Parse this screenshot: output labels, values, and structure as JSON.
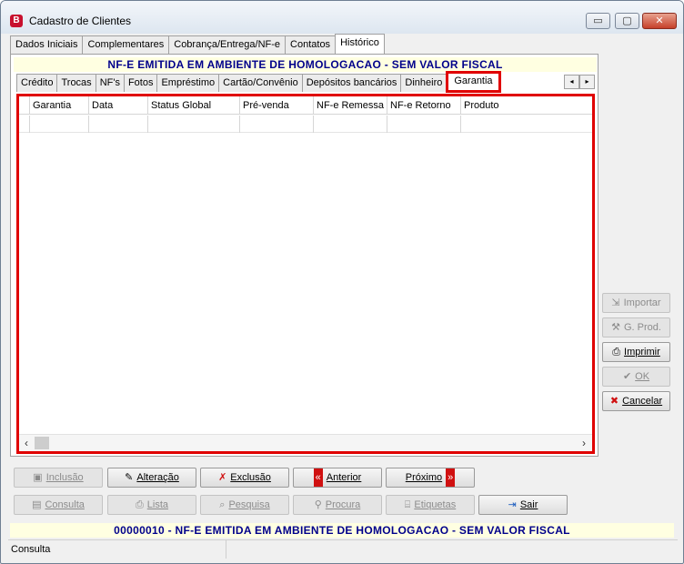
{
  "window": {
    "title": "Cadastro de Clientes",
    "app_icon_letter": "B",
    "min_glyph": "▭",
    "max_glyph": "▢",
    "close_glyph": "✕"
  },
  "main_tabs": [
    {
      "label": "Dados Iniciais"
    },
    {
      "label": "Complementares"
    },
    {
      "label": "Cobrança/Entrega/NF-e"
    },
    {
      "label": "Contatos"
    },
    {
      "label": "Histórico",
      "active": true
    }
  ],
  "banner_top": "NF-E EMITIDA EM AMBIENTE DE HOMOLOGACAO - SEM VALOR FISCAL",
  "sub_tabs": [
    {
      "label": "Crédito"
    },
    {
      "label": "Trocas"
    },
    {
      "label": "NF's"
    },
    {
      "label": "Fotos"
    },
    {
      "label": "Empréstimo"
    },
    {
      "label": "Cartão/Convênio"
    },
    {
      "label": "Depósitos bancários"
    },
    {
      "label": "Dinheiro"
    },
    {
      "label": "Garantia",
      "active": true
    }
  ],
  "tab_scroll": {
    "left": "◂",
    "right": "▸"
  },
  "grid": {
    "columns": [
      "Garantia",
      "Data",
      "Status Global",
      "Pré-venda",
      "NF-e Remessa",
      "NF-e Retorno",
      "Produto"
    ],
    "scroll_left": "‹",
    "scroll_right": "›"
  },
  "side_buttons": {
    "importar": {
      "label": "Importar",
      "icon": "import-icon",
      "glyph": "⇲",
      "enabled": false
    },
    "gprod": {
      "label": "G. Prod.",
      "icon": "tools-icon",
      "glyph": "⚒",
      "enabled": false
    },
    "imprimir": {
      "label": "Imprimir",
      "icon": "printer-icon",
      "glyph": "⎙",
      "enabled": true
    },
    "ok": {
      "label": "OK",
      "icon": "check-icon",
      "glyph": "✔",
      "enabled": false
    },
    "cancelar": {
      "label": "Cancelar",
      "icon": "cancel-icon",
      "glyph": "✖",
      "enabled": true
    }
  },
  "bottom_buttons_row1": {
    "inclusao": {
      "label": "Inclusão",
      "glyph": "▣",
      "enabled": false
    },
    "alteracao": {
      "label": "Alteração",
      "glyph": "✎",
      "enabled": true
    },
    "exclusao": {
      "label": "Exclusão",
      "glyph": "✗",
      "enabled": true
    },
    "anterior": {
      "label": "Anterior",
      "glyph": "«",
      "enabled": true
    },
    "proximo": {
      "label": "Próximo",
      "glyph": "»",
      "enabled": true
    }
  },
  "bottom_buttons_row2": {
    "consulta": {
      "label": "Consulta",
      "glyph": "▤",
      "enabled": false
    },
    "lista": {
      "label": "Lista",
      "glyph": "⎙",
      "enabled": false
    },
    "pesquisa": {
      "label": "Pesquisa",
      "glyph": "⌕",
      "enabled": false
    },
    "procura": {
      "label": "Procura",
      "glyph": "⚲",
      "enabled": false
    },
    "etiquetas": {
      "label": "Etiquetas",
      "glyph": "⌸",
      "enabled": false
    },
    "sair": {
      "label": "Sair",
      "glyph": "⇥",
      "enabled": true
    }
  },
  "banner_bottom": "00000010 - NF-E EMITIDA EM AMBIENTE DE HOMOLOGACAO - SEM VALOR FISCAL",
  "status_bar": {
    "mode": "Consulta"
  },
  "colors": {
    "highlight_red": "#e00000",
    "banner_bg": "#ffffe1",
    "banner_text": "#00008b",
    "close_red": "#c6402a"
  }
}
